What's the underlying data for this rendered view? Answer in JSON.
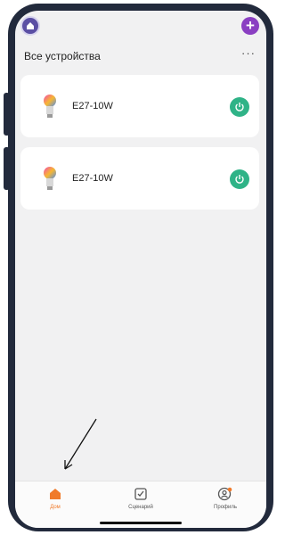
{
  "header": {
    "title": "Все устройства",
    "more_icon": "more-dots-icon",
    "add_icon": "plus-icon"
  },
  "devices": [
    {
      "name": "E27-10W",
      "icon": "bulb-icon",
      "power_icon": "power-icon",
      "power_state": "on"
    },
    {
      "name": "E27-10W",
      "icon": "bulb-icon",
      "power_icon": "power-icon",
      "power_state": "on"
    }
  ],
  "tabs": [
    {
      "label": "Дом",
      "icon": "home-icon",
      "active": true
    },
    {
      "label": "Сценарий",
      "icon": "scenario-icon",
      "active": false
    },
    {
      "label": "Профиль",
      "icon": "profile-icon",
      "active": false
    }
  ],
  "colors": {
    "frame": "#222a3c",
    "accent": "#f07a2a",
    "power": "#2fb387",
    "add": "#8a3fc2"
  }
}
